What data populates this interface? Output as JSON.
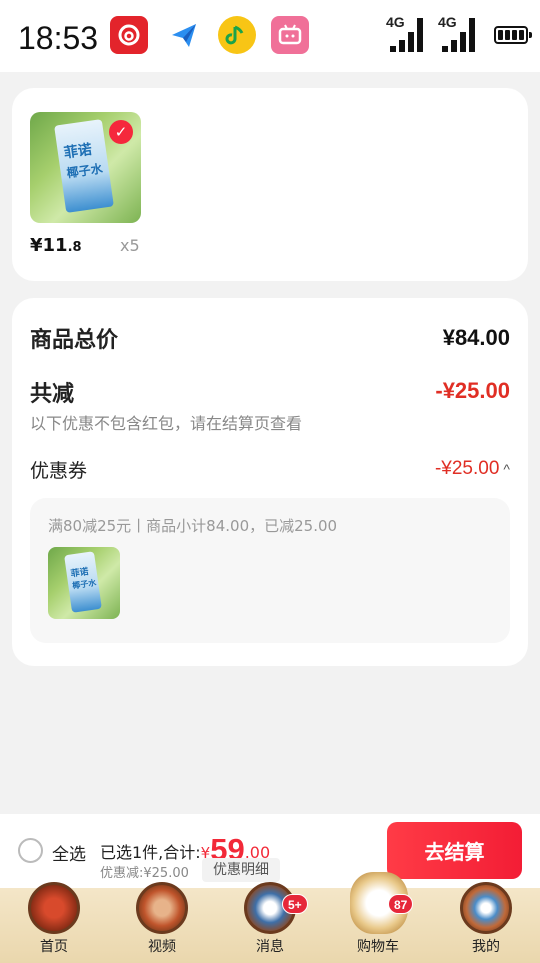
{
  "status_bar": {
    "time": "18:53",
    "net1": "4G",
    "net2": "4G"
  },
  "product": {
    "price_main": "¥11",
    "price_decimal": ".8",
    "quantity": "x5",
    "pack_brand": "菲诺",
    "pack_name": "椰子水"
  },
  "summary": {
    "total_label": "商品总价",
    "total_value": "¥84.00",
    "discount_label": "共减",
    "discount_value": "-¥25.00",
    "note": "以下优惠不包含红包，请在结算页查看",
    "coupon_label": "优惠券",
    "coupon_value": "-¥25.00",
    "coupon_caret": "^",
    "coupon_desc": "满80减25元丨商品小计84.00，已减25.00"
  },
  "bottom_bar": {
    "select_all": "全选",
    "selected_text": "已选1件,合计:",
    "currency": "¥",
    "total_int": "59",
    "total_dec": ".00",
    "discount_text": "优惠减:¥25.00",
    "detail_label": "优惠明细",
    "checkout_label": "去结算"
  },
  "tabs": [
    {
      "label": "首页",
      "icon": "home-temple-icon"
    },
    {
      "label": "视频",
      "icon": "video-figure-icon"
    },
    {
      "label": "消息",
      "icon": "message-mask-icon",
      "badge": "5+"
    },
    {
      "label": "购物车",
      "icon": "cart-deer-icon",
      "badge": "87"
    },
    {
      "label": "我的",
      "icon": "profile-emblem-icon"
    }
  ],
  "colors": {
    "accent_red": "#f22938",
    "price_red": "#e02e24",
    "tab_bg": "#f1e2c2"
  }
}
